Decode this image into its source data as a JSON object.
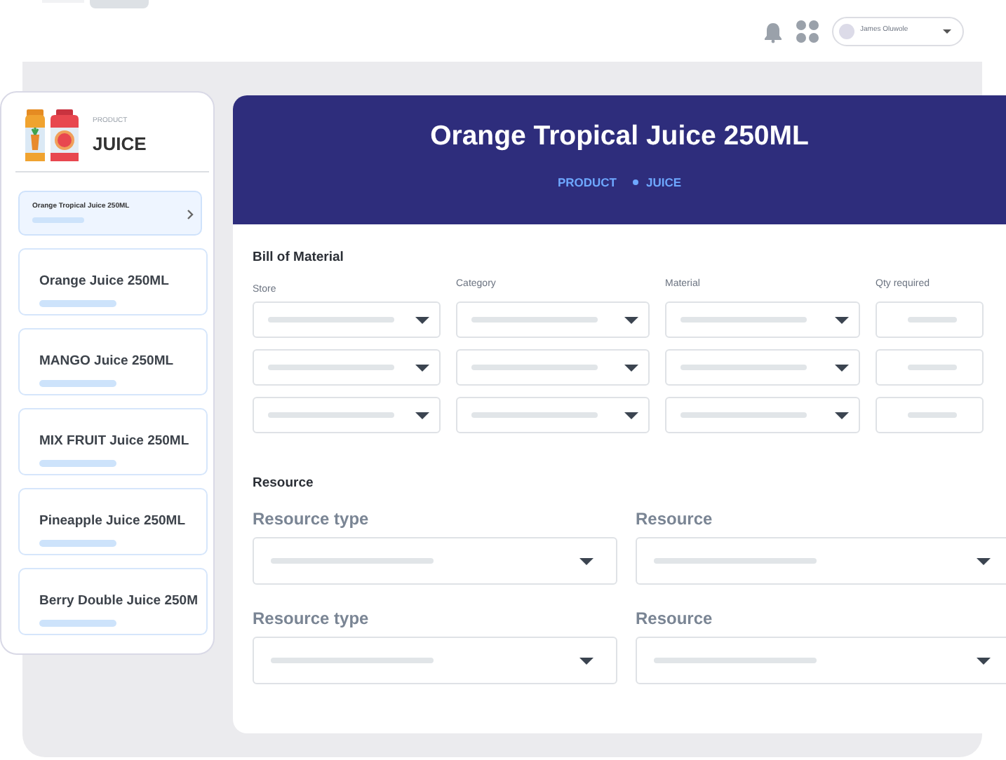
{
  "topbar": {
    "user_name": "James Oluwole"
  },
  "sidebar": {
    "category_label": "PRODUCT",
    "category": "JUICE",
    "products": [
      {
        "name": "Orange Tropical Juice 250ML",
        "selected": true
      },
      {
        "name": "Orange Juice 250ML",
        "selected": false
      },
      {
        "name": "MANGO  Juice 250ML",
        "selected": false
      },
      {
        "name": "MIX FRUIT Juice 250ML",
        "selected": false
      },
      {
        "name": "Pineapple Juice 250ML",
        "selected": false
      },
      {
        "name": "Berry Double Juice 250M",
        "selected": false
      }
    ]
  },
  "detail": {
    "title": "Orange Tropical Juice 250ML",
    "breadcrumb": [
      "PRODUCT",
      "JUICE"
    ],
    "bill_of_material": {
      "title": "Bill of Material",
      "columns": [
        {
          "label": "Store"
        },
        {
          "label": "Category"
        },
        {
          "label": "Material"
        },
        {
          "label": "Qty required"
        }
      ],
      "rows": [
        {
          "cells": [
            {
              "kind": "select"
            },
            {
              "kind": "select"
            },
            {
              "kind": "select"
            },
            {
              "kind": "input"
            }
          ]
        },
        {
          "cells": [
            {
              "kind": "select"
            },
            {
              "kind": "select"
            },
            {
              "kind": "select"
            },
            {
              "kind": "input"
            }
          ]
        },
        {
          "cells": [
            {
              "kind": "select"
            },
            {
              "kind": "select"
            },
            {
              "kind": "select"
            },
            {
              "kind": "input"
            }
          ]
        }
      ]
    },
    "resource": {
      "title": "Resource",
      "rows": [
        {
          "fields": [
            {
              "label": "Resource type"
            },
            {
              "label": "Resource"
            }
          ]
        },
        {
          "fields": [
            {
              "label": "Resource type"
            },
            {
              "label": "Resource"
            }
          ]
        }
      ]
    }
  }
}
